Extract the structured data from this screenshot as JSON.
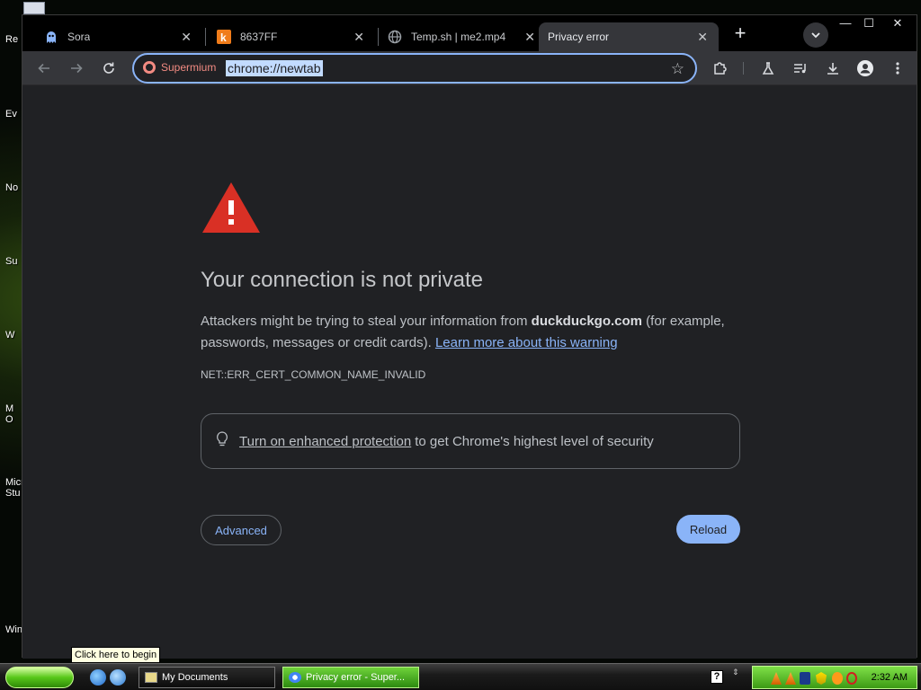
{
  "desktop": {
    "labels": [
      "Re",
      "Ev",
      "No",
      "Su",
      "W",
      "M",
      "O",
      "Micro",
      "Stu",
      "Wind"
    ]
  },
  "browser": {
    "tabs": [
      {
        "title": "Sora",
        "icon": "ghost-icon"
      },
      {
        "title": "8637FF",
        "icon": "k-icon"
      },
      {
        "title": "Temp.sh | me2.mp4",
        "icon": "globe-icon"
      },
      {
        "title": "Privacy error",
        "icon": "none",
        "active": true
      }
    ],
    "omnibox": {
      "site_chip": "Supermium",
      "url": "chrome://newtab"
    }
  },
  "page": {
    "heading": "Your connection is not private",
    "desc_prefix": "Attackers might be trying to steal your information from ",
    "domain": "duckduckgo.com",
    "desc_suffix": " (for example, passwords, messages or credit cards). ",
    "learn_link": "Learn more about this warning",
    "error_code": "NET::ERR_CERT_COMMON_NAME_INVALID",
    "protect_link": "Turn on enhanced protection",
    "protect_text": "to get Chrome's highest level of security",
    "advanced_label": "Advanced",
    "reload_label": "Reload"
  },
  "taskbar": {
    "start_tooltip": "Click here to begin",
    "tasks": [
      "My Documents",
      "Privacy error - Super..."
    ],
    "help": "?",
    "clock": "2:32 AM"
  },
  "colors": {
    "accent": "#8ab4f8",
    "warning": "#d93025",
    "page_bg": "#202124",
    "taskbar_green": "#3c9a14"
  }
}
